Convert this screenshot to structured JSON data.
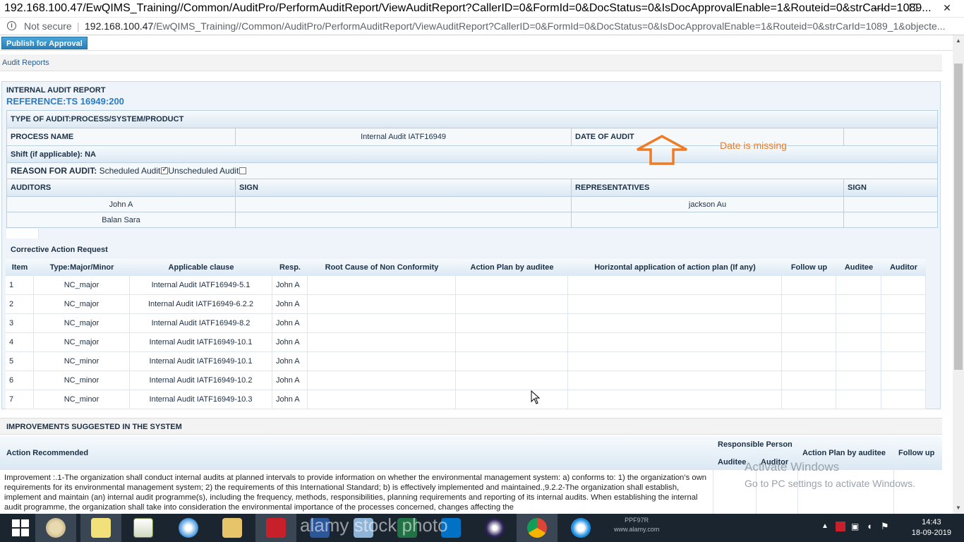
{
  "browser": {
    "title": "192.168.100.47/EwQIMS_Training//Common/AuditPro/PerformAuditReport/ViewAuditReport?CallerID=0&FormId=0&DocStatus=0&IsDocApprovalEnable=1&Routeid=0&strCarId=1089...",
    "security_label": "Not secure",
    "url_host": "192.168.100.47",
    "url_path": "/EwQIMS_Training//Common/AuditPro/PerformAuditReport/ViewAuditReport?CallerID=0&FormId=0&DocStatus=0&IsDocApprovalEnable=1&Routeid=0&strCarId=1089_1&objecte..."
  },
  "toolbar": {
    "publish_label": "Publish for Approval"
  },
  "breadcrumb": {
    "label": "Audit Reports"
  },
  "report": {
    "heading": "INTERNAL AUDIT REPORT",
    "reference": "REFERENCE:TS 16949:200",
    "type_of_audit": "TYPE OF AUDIT:PROCESS/SYSTEM/PRODUCT",
    "process_name_label": "PROCESS NAME",
    "process_name_value": "Internal Audit IATF16949",
    "date_label": "DATE OF AUDIT",
    "date_value": "",
    "shift_label": "Shift (if applicable): NA",
    "reason_label": "REASON FOR AUDIT:",
    "reason_scheduled": "Scheduled Audit",
    "reason_unscheduled": "Unscheduled Audit",
    "auditors_label": "AUDITORS",
    "sign_label": "SIGN",
    "representatives_label": "REPRESENTATIVES",
    "sign2_label": "SIGN",
    "auditors": [
      "John A",
      "Balan Sara"
    ],
    "representatives": [
      "jackson Au",
      ""
    ]
  },
  "annotation": {
    "text": "Date is missing",
    "color": "#f07b22"
  },
  "car": {
    "title": "Corrective Action Request",
    "headers": [
      "Item",
      "Type:Major/Minor",
      "Applicable clause",
      "Resp.",
      "Root Cause of Non Conformity",
      "Action Plan by auditee",
      "Horizontal application of action plan (If any)",
      "Follow up",
      "Auditee",
      "Auditor"
    ],
    "rows": [
      [
        "1",
        "NC_major",
        "Internal Audit IATF16949-5.1",
        "John A"
      ],
      [
        "2",
        "NC_major",
        "Internal Audit IATF16949-6.2.2",
        "John A"
      ],
      [
        "3",
        "NC_major",
        "Internal Audit IATF16949-8.2",
        "John A"
      ],
      [
        "4",
        "NC_major",
        "Internal Audit IATF16949-10.1",
        "John A"
      ],
      [
        "5",
        "NC_minor",
        "Internal Audit IATF16949-10.1",
        "John A"
      ],
      [
        "6",
        "NC_minor",
        "Internal Audit IATF16949-10.2",
        "John A"
      ],
      [
        "7",
        "NC_minor",
        "Internal Audit IATF16949-10.3",
        "John A"
      ]
    ]
  },
  "improvements": {
    "title": "IMPROVEMENTS SUGGESTED IN THE SYSTEM",
    "action_recommended": "Action Recommended",
    "responsible_person": "Responsible Person",
    "auditee": "Auditee",
    "auditor": "Auditor",
    "action_plan": "Action Plan by auditee",
    "follow_up": "Follow up",
    "body": "Improvement :.1-The organization shall conduct internal audits at planned intervals to provide information on whether the environmental management system: a) conforms to: 1) the organization’s own requirements for its environmental management system; 2) the requirements of this International Standard; b) is effectively implemented and maintained.,9.2.2-The organization shall establish, implement and maintain (an) internal audit programme(s), including the frequency, methods, responsibilities, planning requirements and reporting of its internal audits. When establishing the internal audit programme, the organization shall take into consideration the environmental importance of the processes concerned, changes affecting the"
  },
  "watermark": {
    "line1": "Activate Windows",
    "line2": "Go to PC settings to activate Windows.",
    "stock": "alamy stock photo"
  },
  "taskbar": {
    "ppf_line1": "PPF97R",
    "ppf_line2": "www.alamy.com",
    "time": "14:43",
    "date": "18-09-2019"
  }
}
